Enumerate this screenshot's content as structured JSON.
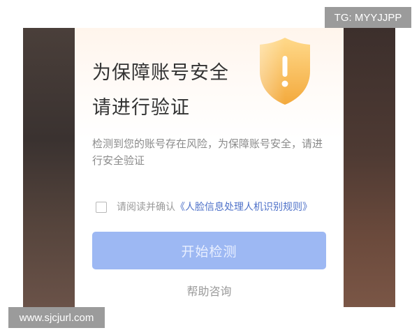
{
  "watermarks": {
    "top_right": "TG: MYYJJPP",
    "bottom_left": "www.sjcjurl.com"
  },
  "dialog": {
    "icon": "shield-warning-icon",
    "title_line1": "为保障账号安全",
    "title_line2": "请进行验证",
    "description": "检测到您的账号存在风险，为保障账号安全，请进行安全验证",
    "consent": {
      "checked": false,
      "prefix": "请阅读并确认",
      "link_text": "《人脸信息处理人机识别规则》"
    },
    "start_button_label": "开始检测",
    "help_label": "帮助咨询"
  },
  "colors": {
    "primary_button_disabled": "#9db8f3",
    "link": "#4f72c9",
    "shield": "#f5b94e"
  }
}
